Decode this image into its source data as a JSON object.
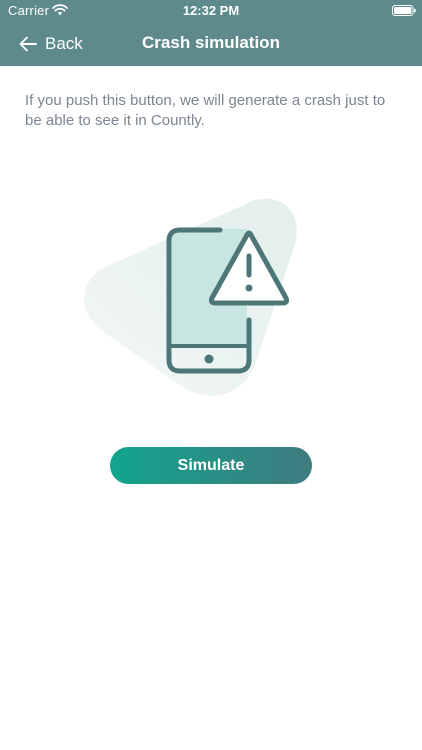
{
  "status_bar": {
    "carrier": "Carrier",
    "time": "12:32 PM"
  },
  "nav": {
    "back_label": "Back",
    "title": "Crash simulation"
  },
  "content": {
    "description": "If you push this button, we will generate a crash just to be able to see it in Countly.",
    "button_label": "Simulate"
  },
  "icons": {
    "back": "arrow-left-icon",
    "wifi": "wifi-icon",
    "battery": "battery-icon",
    "illustration": "phone-warning-icon"
  },
  "colors": {
    "header": "#5e8a8c",
    "accent_start": "#12a58b",
    "accent_end": "#3f7b7e",
    "text_muted": "#7b8591",
    "illustration_stroke": "#4d7678",
    "illustration_fill": "#c7e6e1"
  }
}
